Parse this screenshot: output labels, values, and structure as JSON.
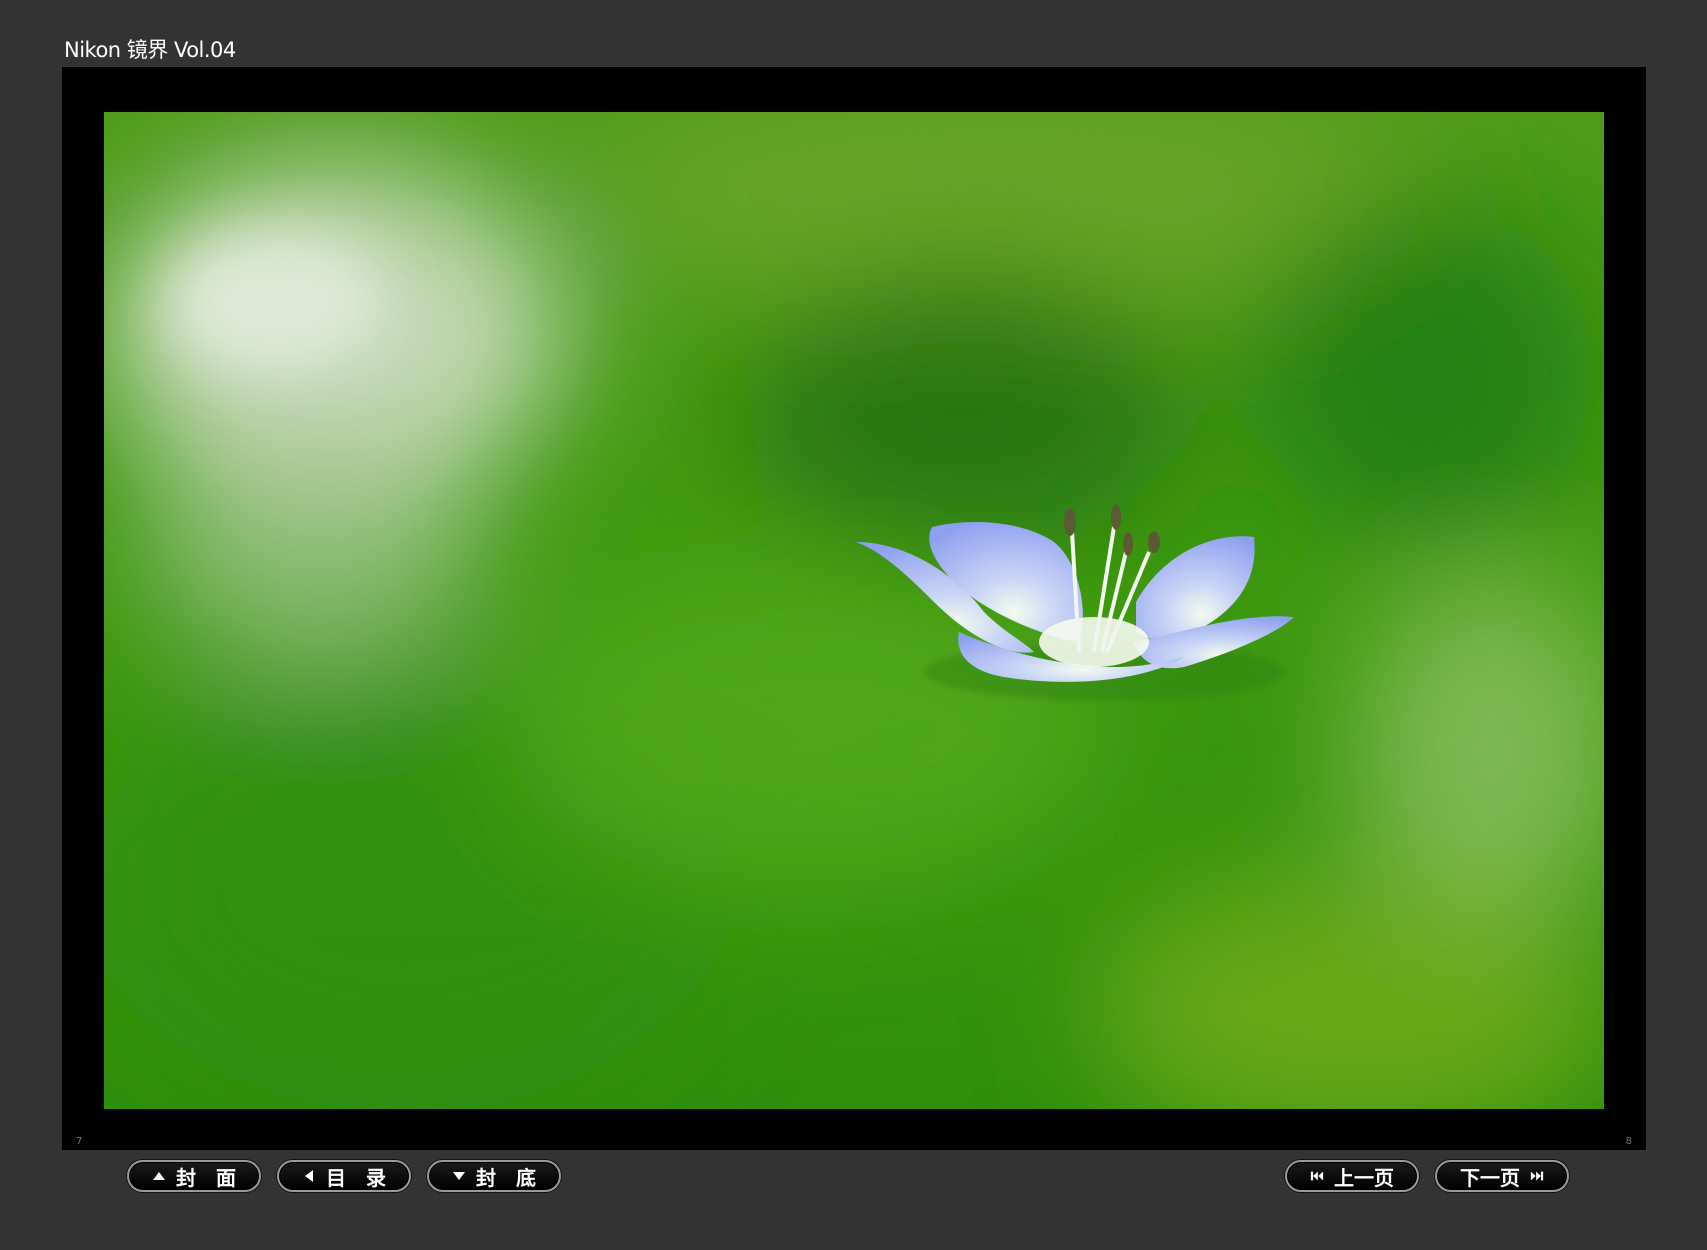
{
  "header": {
    "title": "Nikon 镜界 Vol.04"
  },
  "viewer": {
    "left_page_number": "7",
    "right_page_number": "8",
    "photo_subject": "blue-flower-on-green-bokeh"
  },
  "nav": {
    "cover_label": "封　面",
    "toc_label": "目　录",
    "back_cover_label": "封　底",
    "prev_label": "上一页",
    "next_label": "下一页"
  },
  "colors": {
    "background": "#333333",
    "frame": "#000000",
    "button_border": "#9a9a9a",
    "text": "#ffffff"
  },
  "icons": {
    "cover": "triangle-up-icon",
    "toc": "triangle-left-icon",
    "back_cover": "triangle-down-icon",
    "prev": "skip-back-icon",
    "next": "skip-forward-icon"
  }
}
